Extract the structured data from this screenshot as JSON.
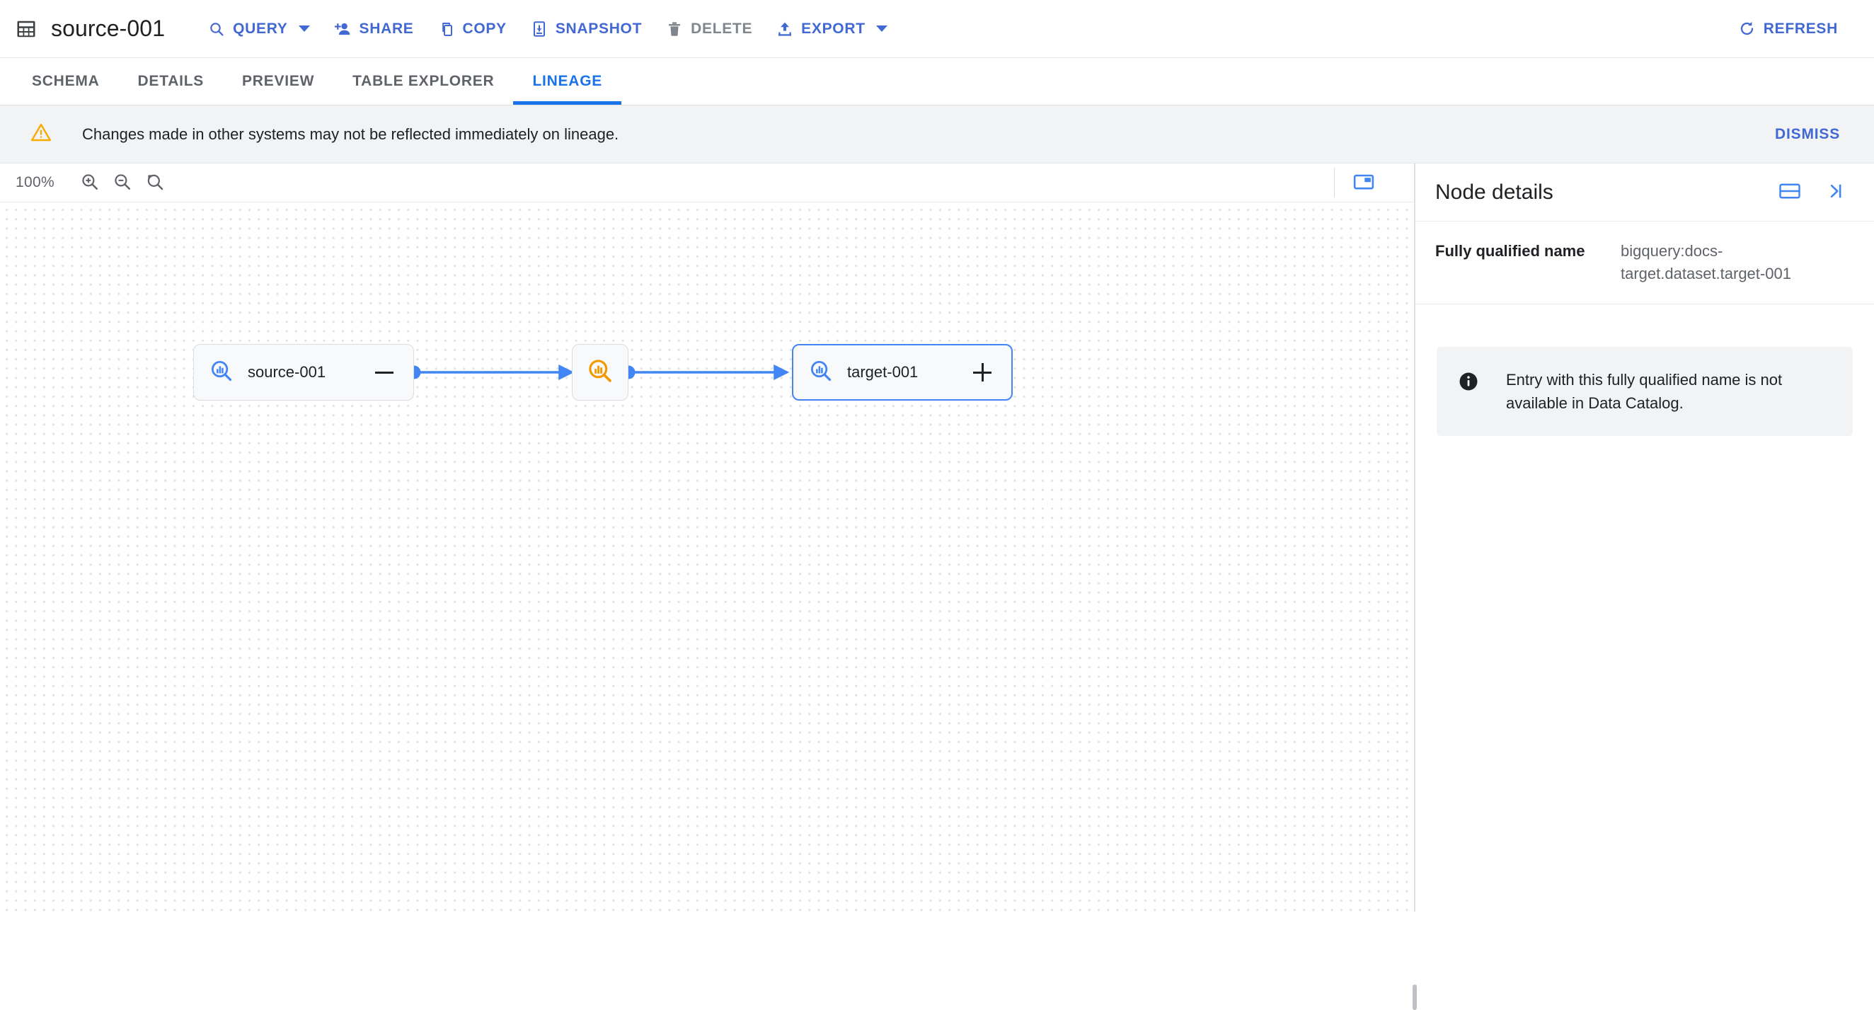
{
  "header": {
    "table_icon": "table-grid-icon",
    "title": "source-001",
    "actions": [
      {
        "id": "query",
        "label": "QUERY",
        "icon": "search-icon",
        "has_caret": true,
        "disabled": false
      },
      {
        "id": "share",
        "label": "SHARE",
        "icon": "person-add-icon",
        "has_caret": false,
        "disabled": false
      },
      {
        "id": "copy",
        "label": "COPY",
        "icon": "copy-icon",
        "has_caret": false,
        "disabled": false
      },
      {
        "id": "snapshot",
        "label": "SNAPSHOT",
        "icon": "snapshot-icon",
        "has_caret": false,
        "disabled": false
      },
      {
        "id": "delete",
        "label": "DELETE",
        "icon": "trash-icon",
        "has_caret": false,
        "disabled": true
      },
      {
        "id": "export",
        "label": "EXPORT",
        "icon": "export-icon",
        "has_caret": true,
        "disabled": false
      }
    ],
    "refresh": {
      "label": "REFRESH",
      "icon": "refresh-icon"
    }
  },
  "tabs": [
    {
      "label": "SCHEMA",
      "active": false
    },
    {
      "label": "DETAILS",
      "active": false
    },
    {
      "label": "PREVIEW",
      "active": false
    },
    {
      "label": "TABLE EXPLORER",
      "active": false
    },
    {
      "label": "LINEAGE",
      "active": true
    }
  ],
  "banner": {
    "icon": "warning-triangle-icon",
    "message": "Changes made in other systems may not be reflected immediately on lineage.",
    "dismiss_label": "DISMISS"
  },
  "canvas_toolbar": {
    "zoom_level": "100%",
    "zoom_in_icon": "zoom-in-icon",
    "zoom_out_icon": "zoom-out-icon",
    "zoom_reset_icon": "zoom-reset-icon",
    "minimap_icon": "minimap-icon"
  },
  "graph": {
    "nodes": [
      {
        "id": "source",
        "label": "source-001",
        "type": "table",
        "icon": "data-search-blue-icon",
        "toggle": "minus",
        "selected": false
      },
      {
        "id": "proc",
        "label": "",
        "type": "process",
        "icon": "data-search-orange-icon",
        "toggle": "",
        "selected": false
      },
      {
        "id": "target",
        "label": "target-001",
        "type": "table",
        "icon": "data-search-blue-icon",
        "toggle": "plus",
        "selected": true
      }
    ],
    "edges": [
      {
        "from": "source",
        "to": "proc"
      },
      {
        "from": "proc",
        "to": "target"
      }
    ],
    "edge_color": "#4285f4"
  },
  "panel": {
    "title": "Node details",
    "dock_icon": "split-pane-icon",
    "collapse_icon": "collapse-right-icon",
    "details": [
      {
        "key": "Fully qualified name",
        "value": "bigquery:docs-target.dataset.target-001"
      }
    ],
    "info": {
      "icon": "info-circle-icon",
      "message": "Entry with this fully qualified name is not available in Data Catalog."
    }
  },
  "colors": {
    "accent_blue": "#1a73e8",
    "link_blue": "#4268d3",
    "node_icon_blue": "#4285f4",
    "node_icon_orange": "#f29900",
    "warning_amber": "#f9ab00",
    "disabled_grey": "#80868b",
    "banner_bg": "#f1f3f4"
  }
}
